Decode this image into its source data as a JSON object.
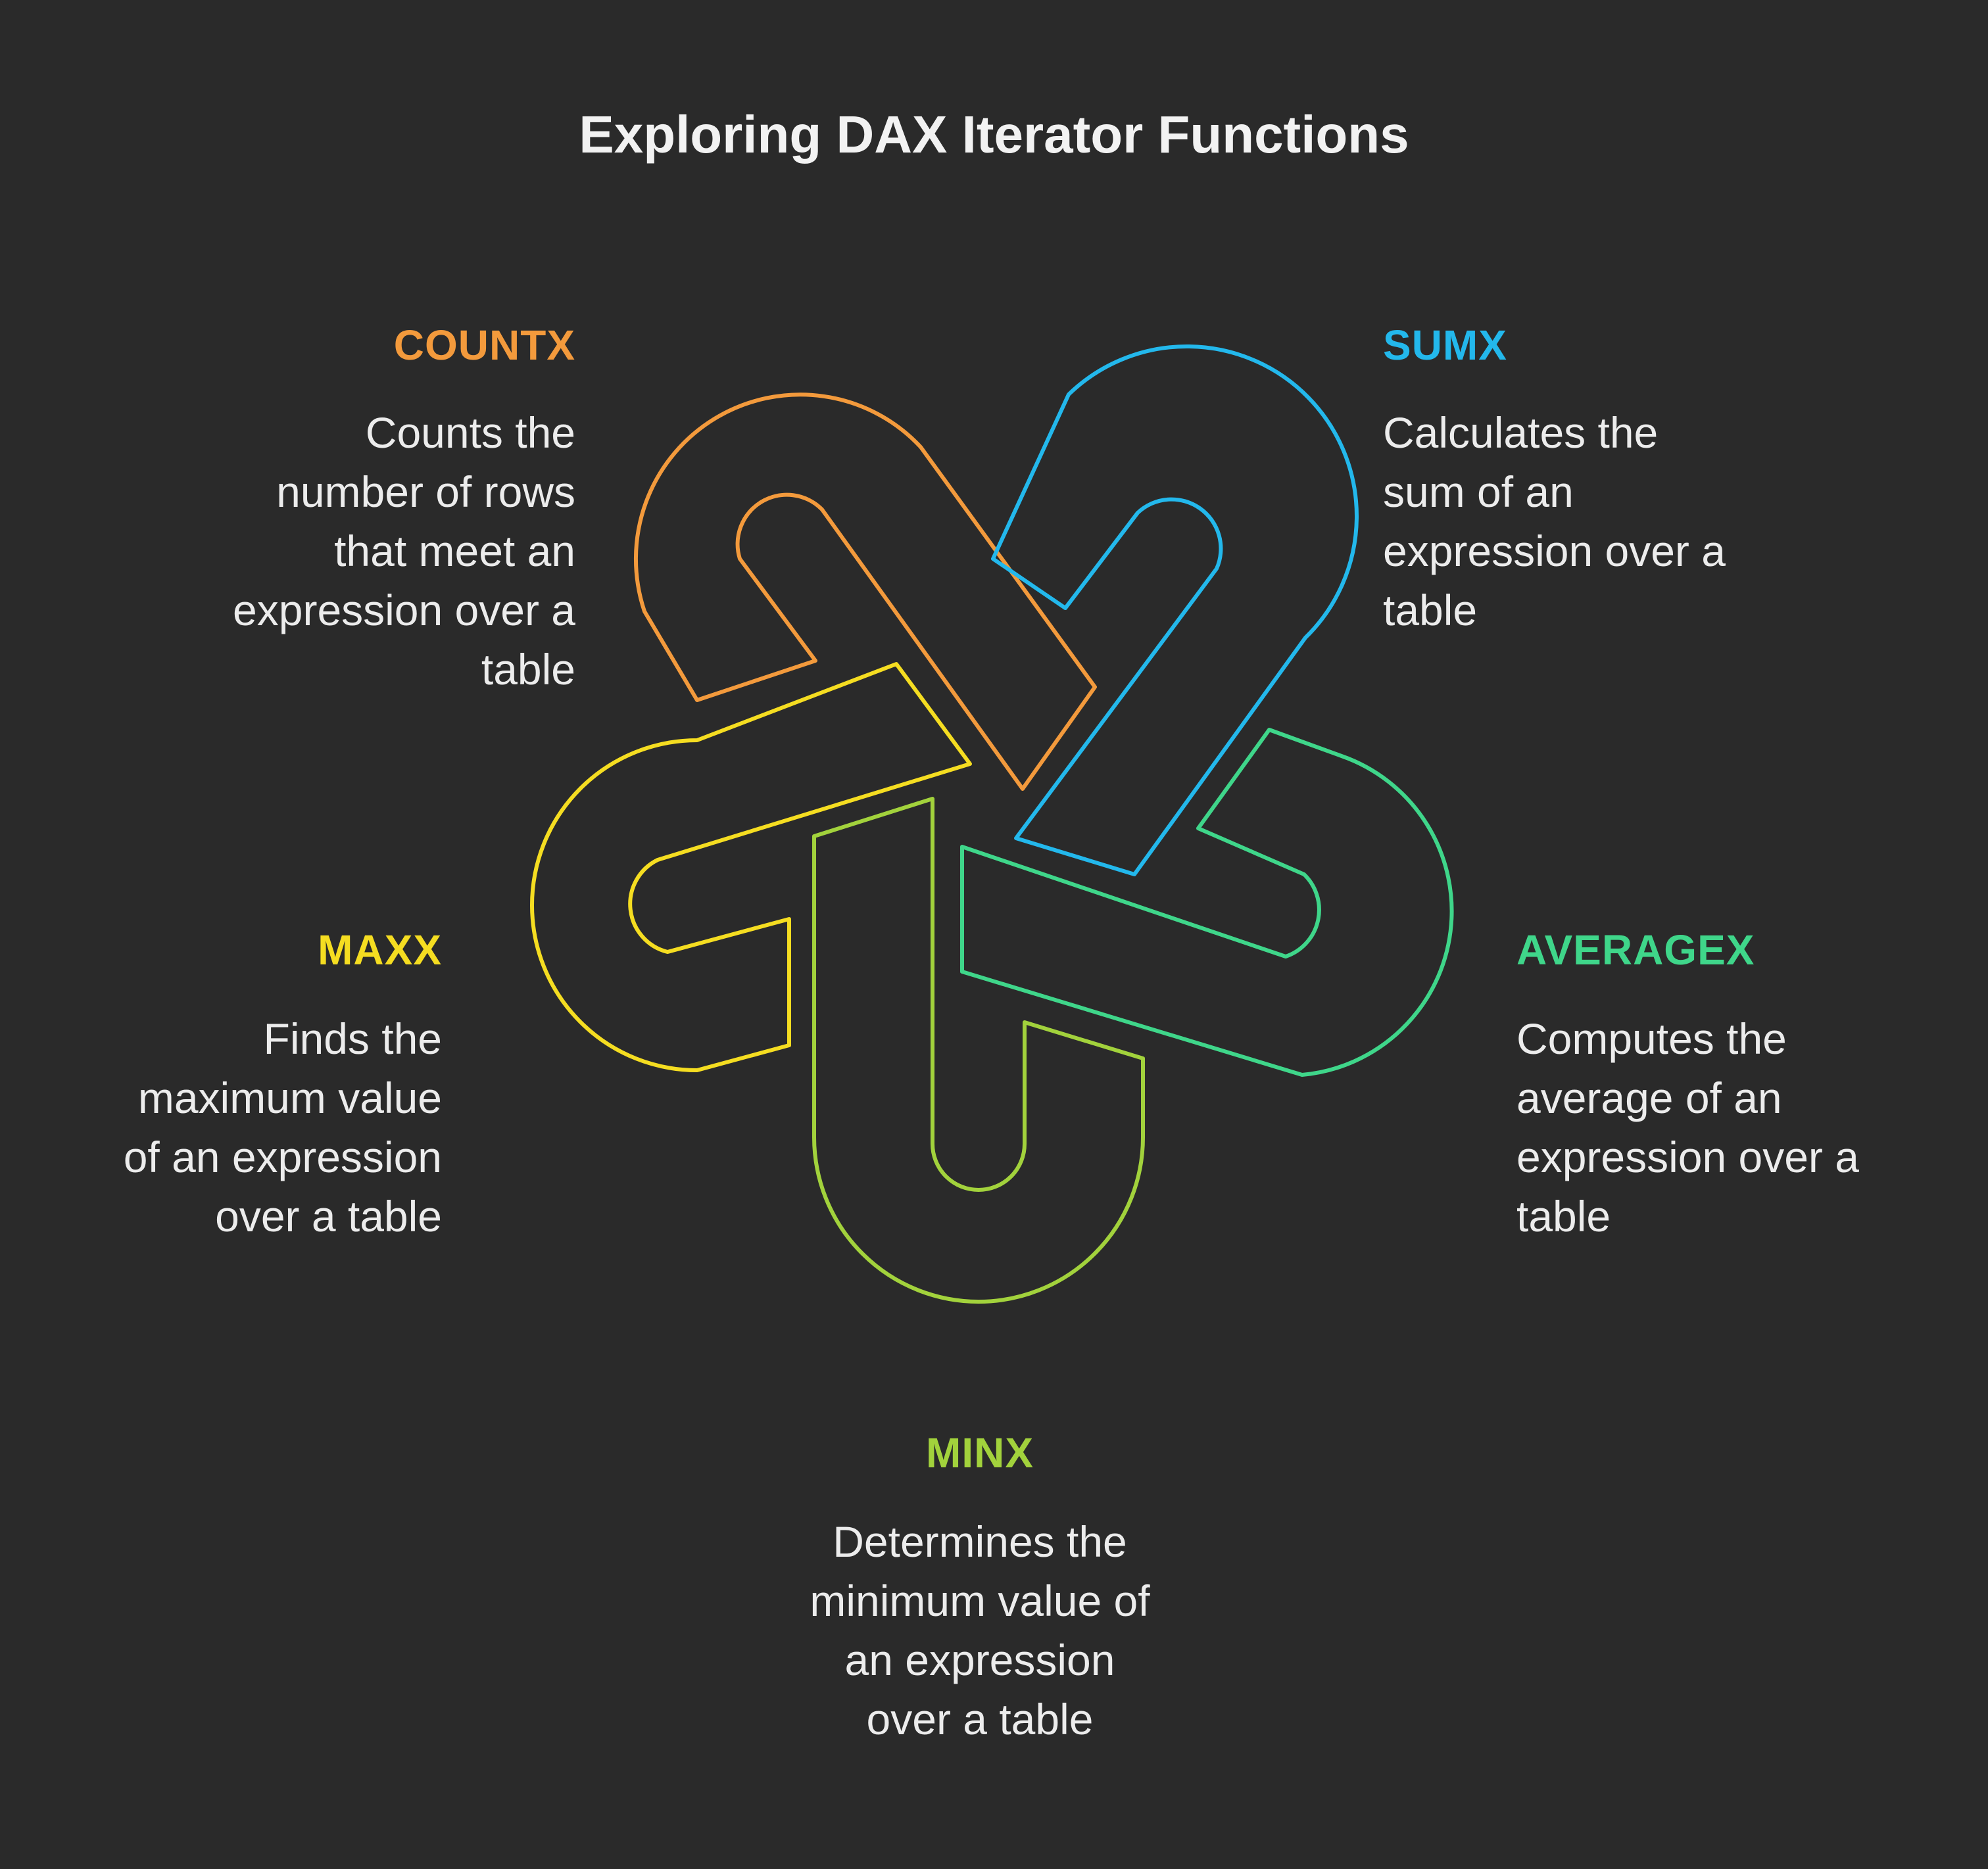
{
  "title": "Exploring DAX Iterator Functions",
  "items": [
    {
      "label": "COUNTX",
      "desc": "Counts the\nnumber of rows\nthat meet an\nexpression over a\ntable",
      "color": "#f39a3c"
    },
    {
      "label": "SUMX",
      "desc": "Calculates the\nsum of an\nexpression over a\ntable",
      "color": "#23b8ec"
    },
    {
      "label": "MAXX",
      "desc": "Finds the\nmaximum value\nof an expression\nover a table",
      "color": "#f5dd21"
    },
    {
      "label": "AVERAGEX",
      "desc": "Computes the\naverage of an\nexpression over a\ntable",
      "color": "#3fd68a"
    },
    {
      "label": "MINX",
      "desc": "Determines the\nminimum value of\nan expression\nover a table",
      "color": "#a2d23c"
    }
  ]
}
